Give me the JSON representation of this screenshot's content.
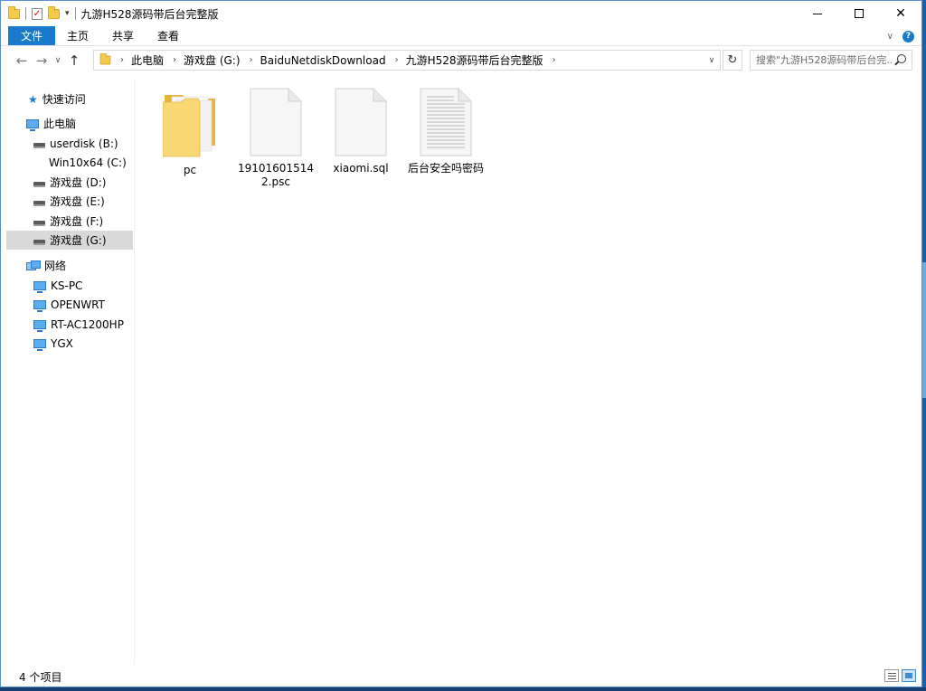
{
  "window": {
    "title": "九游H528源码带后台完整版"
  },
  "ribbon": {
    "tabs": [
      "文件",
      "主页",
      "共享",
      "查看"
    ]
  },
  "address": {
    "crumbs": [
      "此电脑",
      "游戏盘 (G:)",
      "BaiduNetdiskDownload",
      "九游H528源码带后台完整版"
    ]
  },
  "search": {
    "placeholder": "搜索\"九游H528源码带后台完..."
  },
  "sidebar": {
    "items": [
      {
        "label": "快速访问",
        "icon": "star-icon"
      },
      {
        "label": "此电脑",
        "icon": "computer-icon"
      },
      {
        "label": "userdisk (B:)",
        "icon": "drive-icon"
      },
      {
        "label": "Win10x64 (C:)",
        "icon": "windows-drive-icon"
      },
      {
        "label": "游戏盘 (D:)",
        "icon": "drive-icon"
      },
      {
        "label": "游戏盘 (E:)",
        "icon": "drive-icon"
      },
      {
        "label": "游戏盘 (F:)",
        "icon": "drive-icon"
      },
      {
        "label": "游戏盘 (G:)",
        "icon": "drive-icon",
        "selected": true
      },
      {
        "label": "网络",
        "icon": "network-icon"
      },
      {
        "label": "KS-PC",
        "icon": "computer-icon"
      },
      {
        "label": "OPENWRT",
        "icon": "computer-icon"
      },
      {
        "label": "RT-AC1200HP",
        "icon": "computer-icon"
      },
      {
        "label": "YGX",
        "icon": "computer-icon"
      }
    ]
  },
  "files": [
    {
      "name": "pc",
      "type": "folder"
    },
    {
      "name": "191016015142.psc",
      "type": "file"
    },
    {
      "name": "xiaomi.sql",
      "type": "file"
    },
    {
      "name": "后台安全吗密码",
      "type": "text-document"
    }
  ],
  "status": {
    "count": "4 个项目"
  },
  "colors": {
    "accent": "#1979ca",
    "selection": "#d9d9d9",
    "folder": "#f5c94a"
  }
}
